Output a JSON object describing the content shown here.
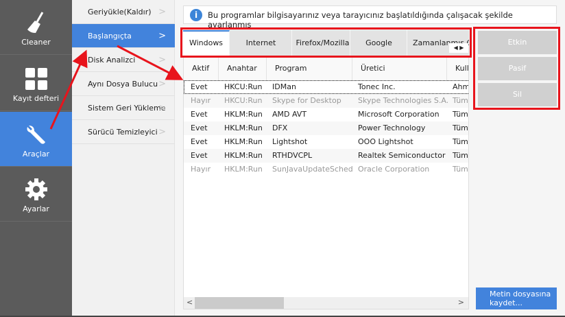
{
  "sidebar": {
    "items": [
      {
        "label": "Cleaner",
        "icon": "broom-icon"
      },
      {
        "label": "Kayıt defteri",
        "icon": "grid-icon"
      },
      {
        "label": "Araçlar",
        "icon": "wrench-icon",
        "active": true
      },
      {
        "label": "Ayarlar",
        "icon": "gear-icon"
      }
    ]
  },
  "submenu": {
    "items": [
      {
        "label": "Geriyükle(Kaldır)"
      },
      {
        "label": "Başlangıçta",
        "active": true
      },
      {
        "label": "Disk Analizci"
      },
      {
        "label": "Aynı Dosya Bulucu"
      },
      {
        "label": "Sistem Geri Yükleme"
      },
      {
        "label": "Sürücü Temizleyici"
      }
    ],
    "chevron": ">"
  },
  "info": {
    "text": "Bu programlar bilgisayarınız veya tarayıcınız başlatıldığında çalışacak şekilde ayarlanmış",
    "icon": "i"
  },
  "tabs": [
    {
      "label": "Windows",
      "active": true
    },
    {
      "label": "Internet Explorer"
    },
    {
      "label": "Firefox/Mozilla"
    },
    {
      "label": "Google Chrome"
    },
    {
      "label": "Zamanlanmış Görevler"
    }
  ],
  "tab_scroll": {
    "left": "◀",
    "right": "▶"
  },
  "table": {
    "columns": [
      "Aktif",
      "Anahtar",
      "Program",
      "Üretici",
      "Kullanıcı"
    ],
    "rows": [
      [
        "Evet",
        "HKCU:Run",
        "IDMan",
        "Tonec Inc.",
        "Ahmet"
      ],
      [
        "Hayır",
        "HKCU:Run",
        "Skype for Desktop",
        "Skype Technologies S.A.",
        "Tüm"
      ],
      [
        "Evet",
        "HKLM:Run",
        "AMD AVT",
        "Microsoft Corporation",
        "Tüm"
      ],
      [
        "Evet",
        "HKLM:Run",
        "DFX",
        "Power Technology",
        "Tüm"
      ],
      [
        "Evet",
        "HKLM:Run",
        "Lightshot",
        "OOO Lightshot",
        "Tüm"
      ],
      [
        "Evet",
        "HKLM:Run",
        "RTHDVCPL",
        "Realtek Semiconductor",
        "Tüm"
      ],
      [
        "Hayır",
        "HKLM:Run",
        "SunJavaUpdateSched",
        "Oracle Corporation",
        "Tüm"
      ]
    ]
  },
  "scroll": {
    "left": "<",
    "right": ">"
  },
  "actions": {
    "enable": "Etkin",
    "disable": "Pasif",
    "delete": "Sil",
    "save": "Metin dosyasına kaydet..."
  },
  "colors": {
    "accent": "#4283dc",
    "annotation": "#e8141c",
    "sidebar": "#5b5b5b"
  }
}
